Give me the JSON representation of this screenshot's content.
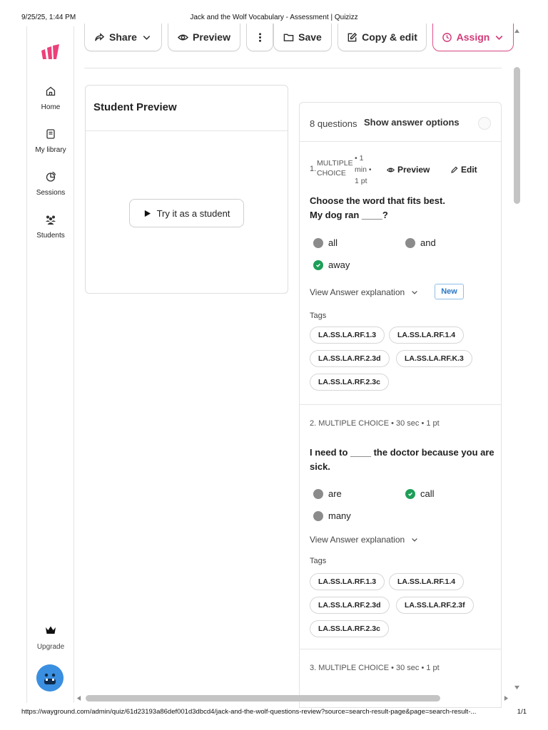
{
  "print": {
    "date": "9/25/25, 1:44 PM",
    "title": "Jack and the Wolf Vocabulary - Assessment | Quizizz",
    "url": "https://wayground.com/admin/quiz/61d23193a86def001d3dbcd4/jack-and-the-wolf-questions-review?source=search-result-page&page=search-result-...",
    "page": "1/1"
  },
  "sidebar": {
    "items": [
      {
        "label": "Home",
        "icon": "home-icon"
      },
      {
        "label": "My library",
        "icon": "library-icon"
      },
      {
        "label": "Sessions",
        "icon": "sessions-icon"
      },
      {
        "label": "Students",
        "icon": "students-icon"
      }
    ],
    "upgrade": "Upgrade",
    "brand_color": "#ec407a"
  },
  "toolbar": {
    "share": "Share",
    "preview": "Preview",
    "save": "Save",
    "copy_edit": "Copy & edit",
    "assign": "Assign",
    "assign_color": "#d23a78"
  },
  "student_preview": {
    "title": "Student Preview",
    "try_button": "Try it as a student"
  },
  "questions": {
    "count": "8 questions",
    "show_answers": "Show answer options",
    "items": [
      {
        "number": "1.",
        "type_line1": "MULTIPLE",
        "type_line2": "CHOICE",
        "time_line1": "• 1",
        "time_line2": "min •",
        "points": "1 pt",
        "preview": "Preview",
        "edit": "Edit",
        "text_line1": "Choose the word that fits best.",
        "text_line2": "My dog ran ____?",
        "options": [
          {
            "label": "all",
            "correct": false
          },
          {
            "label": "and",
            "correct": false
          },
          {
            "label": "away",
            "correct": true
          }
        ],
        "view_explanation": "View Answer explanation",
        "new_badge": "New",
        "tags_label": "Tags",
        "tags": [
          "LA.SS.LA.RF.1.3",
          "LA.SS.LA.RF.1.4",
          "LA.SS.LA.RF.2.3d",
          "LA.SS.LA.RF.K.3",
          "LA.SS.LA.RF.2.3c"
        ]
      },
      {
        "meta": "2. MULTIPLE CHOICE  •  30 sec  •  1 pt",
        "text": "I need to ____ the doctor because you are sick.",
        "options": [
          {
            "label": "are",
            "correct": false
          },
          {
            "label": "call",
            "correct": true
          },
          {
            "label": "many",
            "correct": false
          }
        ],
        "view_explanation": "View Answer explanation",
        "tags_label": "Tags",
        "tags": [
          "LA.SS.LA.RF.1.3",
          "LA.SS.LA.RF.1.4",
          "LA.SS.LA.RF.2.3d",
          "LA.SS.LA.RF.2.3f",
          "LA.SS.LA.RF.2.3c"
        ]
      },
      {
        "meta": "3. MULTIPLE CHOICE  •  30 sec  •  1 pt"
      }
    ]
  }
}
